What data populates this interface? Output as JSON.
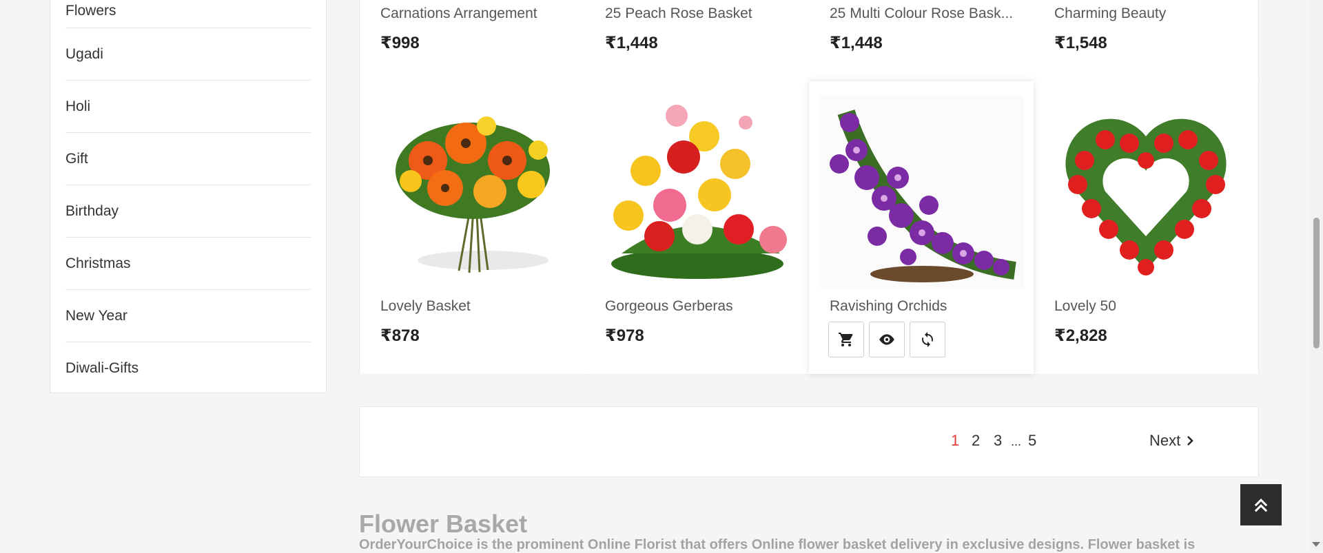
{
  "sidebar": {
    "items": [
      {
        "label": "Flowers"
      },
      {
        "label": "Ugadi"
      },
      {
        "label": "Holi"
      },
      {
        "label": "Gift"
      },
      {
        "label": "Birthday"
      },
      {
        "label": "Christmas"
      },
      {
        "label": "New Year"
      },
      {
        "label": "Diwali-Gifts"
      }
    ]
  },
  "products": {
    "row1": [
      {
        "name": "Carnations Arrangement",
        "price": "₹998"
      },
      {
        "name": "25 Peach Rose Basket",
        "price": "₹1,448"
      },
      {
        "name": "25 Multi Colour Rose Bask...",
        "price": "₹1,448"
      },
      {
        "name": "Charming Beauty",
        "price": "₹1,548"
      }
    ],
    "row2": [
      {
        "name": "Lovely Basket",
        "price": "₹878"
      },
      {
        "name": "Gorgeous Gerberas",
        "price": "₹978"
      },
      {
        "name": "Ravishing Orchids",
        "price": ""
      },
      {
        "name": "Lovely 50",
        "price": "₹2,828"
      }
    ]
  },
  "product_actions": {
    "icons": [
      "cart-icon",
      "eye-icon",
      "refresh-icon"
    ]
  },
  "pagination": {
    "pages": [
      "1",
      "2",
      "3",
      "...",
      "5"
    ],
    "active": "1",
    "next_label": "Next"
  },
  "description": {
    "title": "Flower Basket",
    "text": "OrderYourChoice is the prominent Online Florist that offers Online flower basket delivery in exclusive designs. Flower basket is"
  },
  "colors": {
    "active_page": "#e03a3a",
    "back_to_top_bg": "#2c2c2c"
  }
}
